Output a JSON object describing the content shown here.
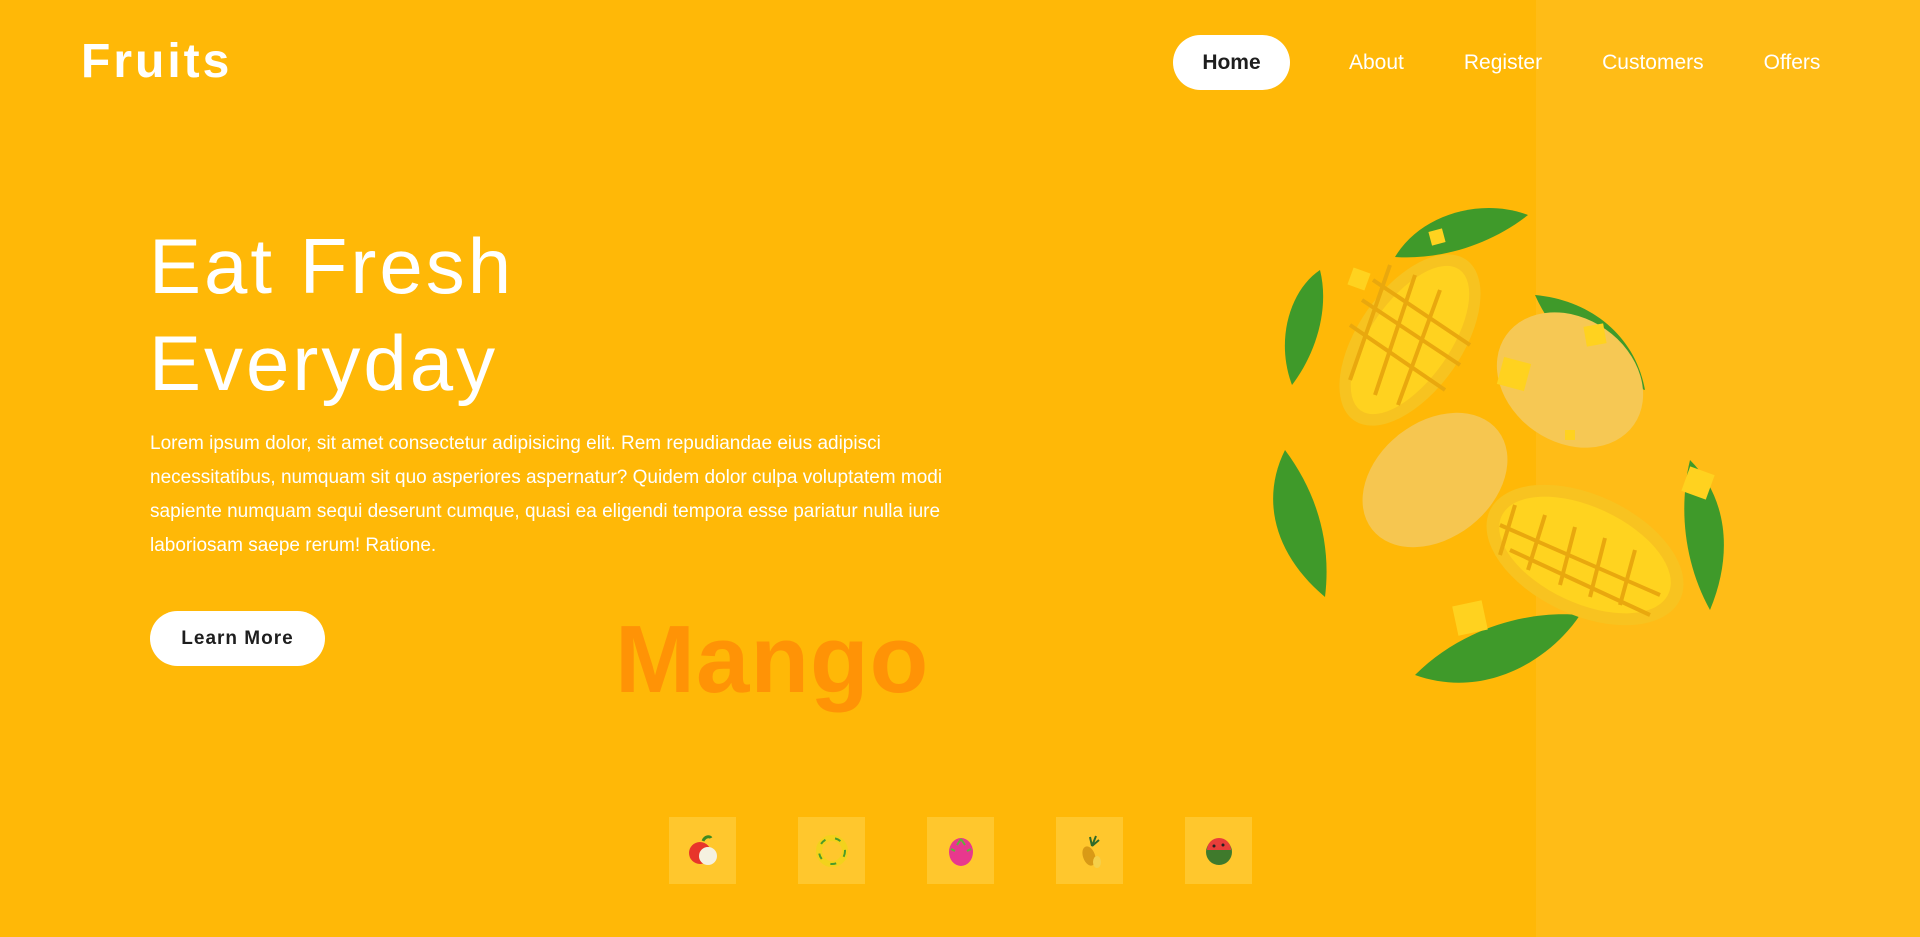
{
  "logo": "Fruits",
  "nav": {
    "items": [
      {
        "label": "Home",
        "active": true
      },
      {
        "label": "About",
        "active": false
      },
      {
        "label": "Register",
        "active": false
      },
      {
        "label": "Customers",
        "active": false
      },
      {
        "label": "Offers",
        "active": false
      }
    ]
  },
  "hero": {
    "title_line1": "Eat Fresh",
    "title_line2": "Everyday",
    "body": "Lorem ipsum dolor, sit amet consectetur adipisicing elit. Rem repudiandae eius adipisci necessitatibus, numquam sit quo asperiores aspernatur? Quidem dolor culpa voluptatem modi sapiente numquam sequi deserunt cumque, quasi ea eligendi tempora esse pariatur nulla iure laboriosam saepe rerum! Ratione.",
    "button_label": "Learn More",
    "background_word": "Mango"
  },
  "thumbnails": [
    {
      "icon": "apple-icon"
    },
    {
      "icon": "banana-icon"
    },
    {
      "icon": "dragonfruit-icon"
    },
    {
      "icon": "pineapple-icon"
    },
    {
      "icon": "watermelon-icon"
    }
  ],
  "colors": {
    "background": "#ffb807",
    "right_panel": "#ffbc17",
    "background_word": "#ff9306",
    "thumb_bg": "#ffc72d",
    "button_bg": "#ffffff",
    "button_text": "#1e1e1e"
  }
}
